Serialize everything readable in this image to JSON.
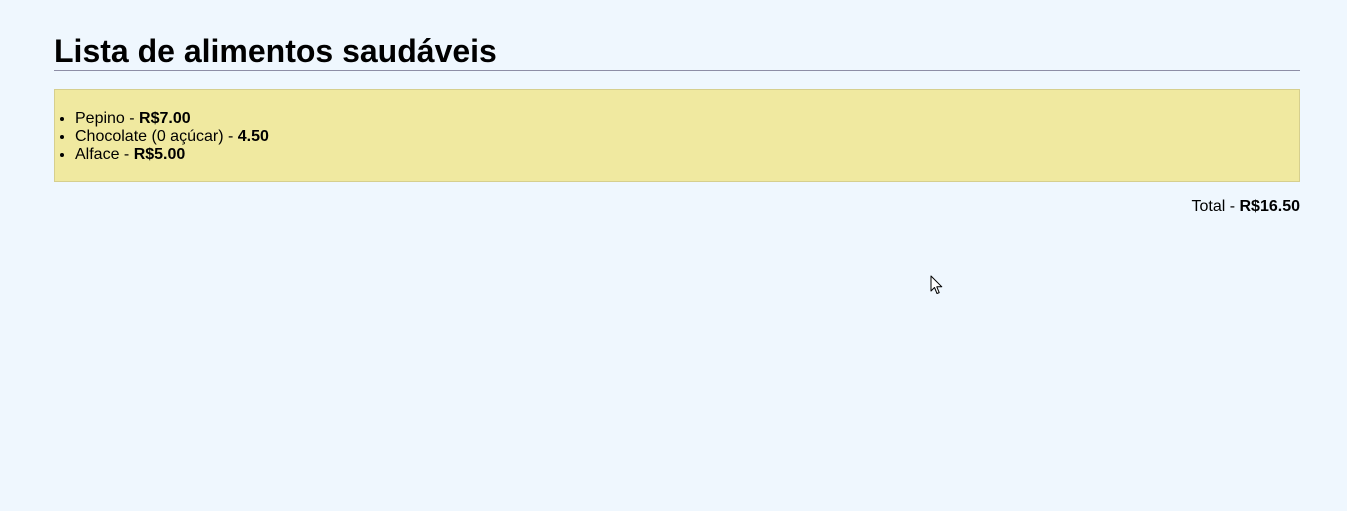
{
  "page": {
    "title": "Lista de alimentos saudáveis"
  },
  "items": [
    {
      "name": "Pepino",
      "separator": " - ",
      "price": "R$7.00"
    },
    {
      "name": "Chocolate (0 açúcar)",
      "separator": " - ",
      "price": "4.50"
    },
    {
      "name": "Alface",
      "separator": " - ",
      "price": "R$5.00"
    }
  ],
  "total": {
    "label": "Total",
    "separator": " - ",
    "value": "R$16.50"
  },
  "colors": {
    "background": "#eff7fe",
    "list_background": "#f0e9a0",
    "title_underline": "#8e8ea6"
  },
  "icons": {
    "cursor": "mouse-pointer-icon"
  }
}
